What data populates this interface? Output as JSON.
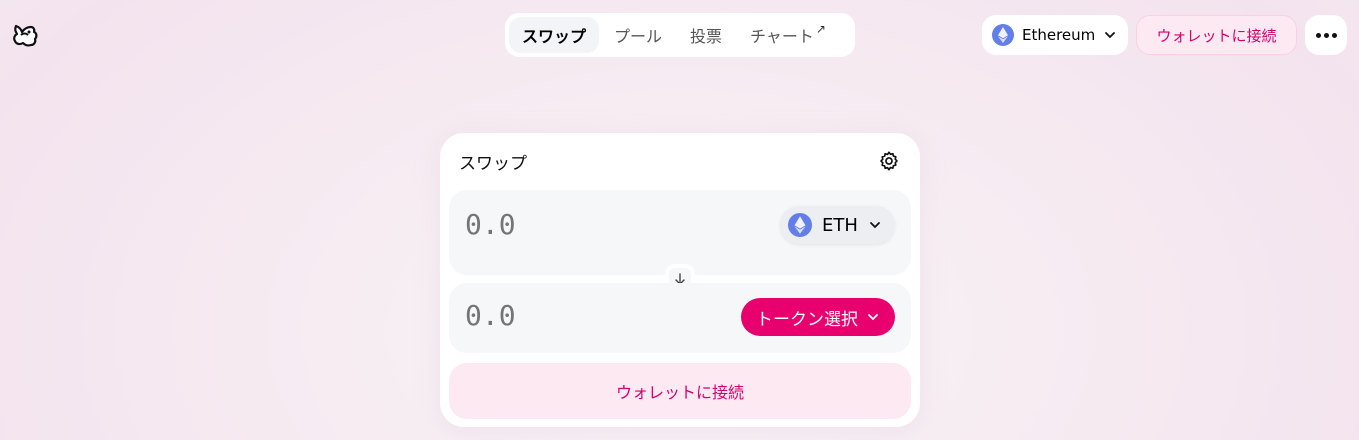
{
  "nav": {
    "tabs": [
      {
        "label": "スワップ"
      },
      {
        "label": "プール"
      },
      {
        "label": "投票"
      },
      {
        "label": "チャート",
        "ext": "↗"
      }
    ]
  },
  "header": {
    "network": "Ethereum",
    "connect_wallet": "ウォレットに接続"
  },
  "swap": {
    "title": "スワップ",
    "input": {
      "placeholder": "0.0",
      "token": "ETH"
    },
    "output": {
      "placeholder": "0.0",
      "select_label": "トークン選択"
    },
    "connect_wallet": "ウォレットに接続"
  },
  "colors": {
    "accent": "#e8006f",
    "accent_text": "#d4006a",
    "accent_soft": "#fde9f2"
  },
  "icons": [
    "uniswap-logo-icon",
    "ethereum-icon",
    "chevron-down-icon",
    "more-icon",
    "gear-icon",
    "arrow-down-icon"
  ]
}
